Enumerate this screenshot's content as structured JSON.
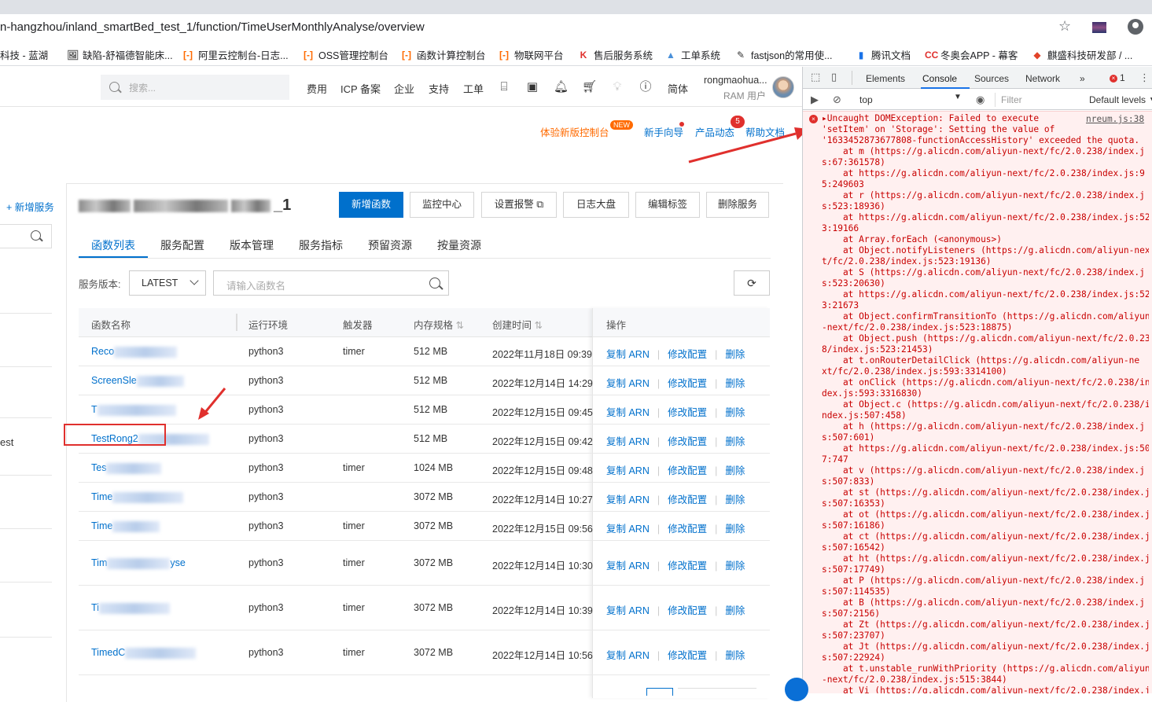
{
  "browser": {
    "url": "n-hangzhou/inland_smartBed_test_1/function/TimeUserMonthlyAnalyse/overview",
    "bookmarks": [
      {
        "label": "科技 - 蓝湖",
        "icon": ""
      },
      {
        "label": "缺陷-舒福德智能床...",
        "icon": "🖼"
      },
      {
        "label": "阿里云控制台-日志...",
        "icon": "[-]"
      },
      {
        "label": "OSS管理控制台",
        "icon": "[-]"
      },
      {
        "label": "函数计算控制台",
        "icon": "[-]"
      },
      {
        "label": "物联网平台",
        "icon": "[-]"
      },
      {
        "label": "售后服务系统",
        "icon": "K"
      },
      {
        "label": "工单系统",
        "icon": "▲"
      },
      {
        "label": "fastjson的常用使...",
        "icon": "✎"
      },
      {
        "label": "腾讯文档",
        "icon": "▮"
      },
      {
        "label": "冬奥会APP - 幕客",
        "icon": "CC"
      },
      {
        "label": "麒盛科技研发部 / ...",
        "icon": "◆"
      }
    ]
  },
  "header": {
    "search_placeholder": "搜索...",
    "nav": [
      "费用",
      "ICP 备案",
      "企业",
      "支持",
      "工单"
    ],
    "lang": "简体",
    "user_name": "rongmaohua...",
    "user_role": "RAM 用户",
    "new_console": "体验新版控制台",
    "new_tag": "NEW",
    "guide": "新手向导",
    "news": "产品动态",
    "news_badge": "5",
    "help": "帮助文档"
  },
  "sidebar": {
    "add_service": "+ 新增服务",
    "partial_item": "est"
  },
  "service": {
    "title_suffix": "_1",
    "buttons": {
      "new_function": "新增函数",
      "monitor": "监控中心",
      "alarm": "设置报警",
      "logs": "日志大盘",
      "tags": "编辑标签",
      "delete": "删除服务"
    },
    "tabs": [
      "函数列表",
      "服务配置",
      "版本管理",
      "服务指标",
      "预留资源",
      "按量资源"
    ],
    "version_label": "服务版本:",
    "version_value": "LATEST",
    "fn_search_placeholder": "请输入函数名"
  },
  "table": {
    "headers": [
      "函数名称",
      "运行环境",
      "触发器",
      "内存规格",
      "创建时间",
      "操作"
    ],
    "ops": {
      "copy_arn": "复制 ARN",
      "edit": "修改配置",
      "delete": "删除"
    },
    "rows": [
      {
        "name": "Reco",
        "runtime": "python3",
        "trigger": "timer",
        "memory": "512 MB",
        "created": "2022年11月18日 09:39"
      },
      {
        "name": "ScreenSle",
        "runtime": "python3",
        "trigger": "",
        "memory": "512 MB",
        "created": "2022年12月14日 14:29"
      },
      {
        "name": "T",
        "runtime": "python3",
        "trigger": "",
        "memory": "512 MB",
        "created": "2022年12月15日 09:45"
      },
      {
        "name": "TestRong2",
        "runtime": "python3",
        "trigger": "",
        "memory": "512 MB",
        "created": "2022年12月15日 09:42"
      },
      {
        "name": "Tes",
        "runtime": "python3",
        "trigger": "timer",
        "memory": "1024 MB",
        "created": "2022年12月15日 09:48"
      },
      {
        "name": "Time",
        "runtime": "python3",
        "trigger": "",
        "memory": "3072 MB",
        "created": "2022年12月14日 10:27"
      },
      {
        "name": "Time",
        "runtime": "python3",
        "trigger": "timer",
        "memory": "3072 MB",
        "created": "2022年12月15日 09:56"
      },
      {
        "name": "Tim",
        "name_tail": "yse",
        "runtime": "python3",
        "trigger": "timer",
        "memory": "3072 MB",
        "created": "2022年12月14日 10:30"
      },
      {
        "name": "Ti",
        "runtime": "python3",
        "trigger": "timer",
        "memory": "3072 MB",
        "created": "2022年12月14日 10:39"
      },
      {
        "name": "TimedC",
        "runtime": "python3",
        "trigger": "timer",
        "memory": "3072 MB",
        "created": "2022年12月14日 10:56"
      }
    ]
  },
  "devtools": {
    "tabs": [
      "Elements",
      "Console",
      "Sources",
      "Network"
    ],
    "more": "»",
    "error_count": "1",
    "context": "top",
    "filter_placeholder": "Filter",
    "levels": "Default levels ▼",
    "source": "nreum.js:38",
    "lines": [
      "▸Uncaught DOMException: Failed to execute",
      "'setItem' on 'Storage': Setting the value of",
      "'1633452873677808-functionAccessHistory' exceeded the quota.",
      "    at m (https://g.alicdn.com/aliyun-next/fc/2.0.238/index.j",
      "s:67:361578)",
      "    at https://g.alicdn.com/aliyun-next/fc/2.0.238/index.js:9",
      "5:249603",
      "    at r (https://g.alicdn.com/aliyun-next/fc/2.0.238/index.j",
      "s:523:18936)",
      "    at https://g.alicdn.com/aliyun-next/fc/2.0.238/index.js:52",
      "3:19166",
      "    at Array.forEach (<anonymous>)",
      "    at Object.notifyListeners (https://g.alicdn.com/aliyun-nex",
      "t/fc/2.0.238/index.js:523:19136)",
      "    at S (https://g.alicdn.com/aliyun-next/fc/2.0.238/index.j",
      "s:523:20630)",
      "    at https://g.alicdn.com/aliyun-next/fc/2.0.238/index.js:52",
      "3:21673",
      "    at Object.confirmTransitionTo (https://g.alicdn.com/aliyun",
      "-next/fc/2.0.238/index.js:523:18875)",
      "    at Object.push (https://g.alicdn.com/aliyun-next/fc/2.0.23",
      "8/index.js:523:21453)",
      "    at t.onRouterDetailClick (https://g.alicdn.com/aliyun-ne",
      "xt/fc/2.0.238/index.js:593:3314100)",
      "    at onClick (https://g.alicdn.com/aliyun-next/fc/2.0.238/in",
      "dex.js:593:3316830)",
      "    at Object.c (https://g.alicdn.com/aliyun-next/fc/2.0.238/i",
      "ndex.js:507:458)",
      "    at h (https://g.alicdn.com/aliyun-next/fc/2.0.238/index.j",
      "s:507:601)",
      "    at https://g.alicdn.com/aliyun-next/fc/2.0.238/index.js:50",
      "7:747",
      "    at v (https://g.alicdn.com/aliyun-next/fc/2.0.238/index.j",
      "s:507:833)",
      "    at st (https://g.alicdn.com/aliyun-next/fc/2.0.238/index.j",
      "s:507:16353)",
      "    at ot (https://g.alicdn.com/aliyun-next/fc/2.0.238/index.j",
      "s:507:16186)",
      "    at ct (https://g.alicdn.com/aliyun-next/fc/2.0.238/index.j",
      "s:507:16542)",
      "    at ht (https://g.alicdn.com/aliyun-next/fc/2.0.238/index.j",
      "s:507:17749)",
      "    at P (https://g.alicdn.com/aliyun-next/fc/2.0.238/index.j",
      "s:507:114535)",
      "    at B (https://g.alicdn.com/aliyun-next/fc/2.0.238/index.j",
      "s:507:2156)",
      "    at Zt (https://g.alicdn.com/aliyun-next/fc/2.0.238/index.j",
      "s:507:23707)",
      "    at Jt (https://g.alicdn.com/aliyun-next/fc/2.0.238/index.j",
      "s:507:22924)",
      "    at t.unstable_runWithPriority (https://g.alicdn.com/aliyun",
      "-next/fc/2.0.238/index.js:515:3844)",
      "    at Vi (https://g.alicdn.com/aliyun-next/fc/2.0.238/index.j"
    ]
  },
  "colors": {
    "accent": "#0070cc",
    "orange": "#ff6a00",
    "error_red": "#c80000",
    "annotation_red": "#e0302d"
  }
}
